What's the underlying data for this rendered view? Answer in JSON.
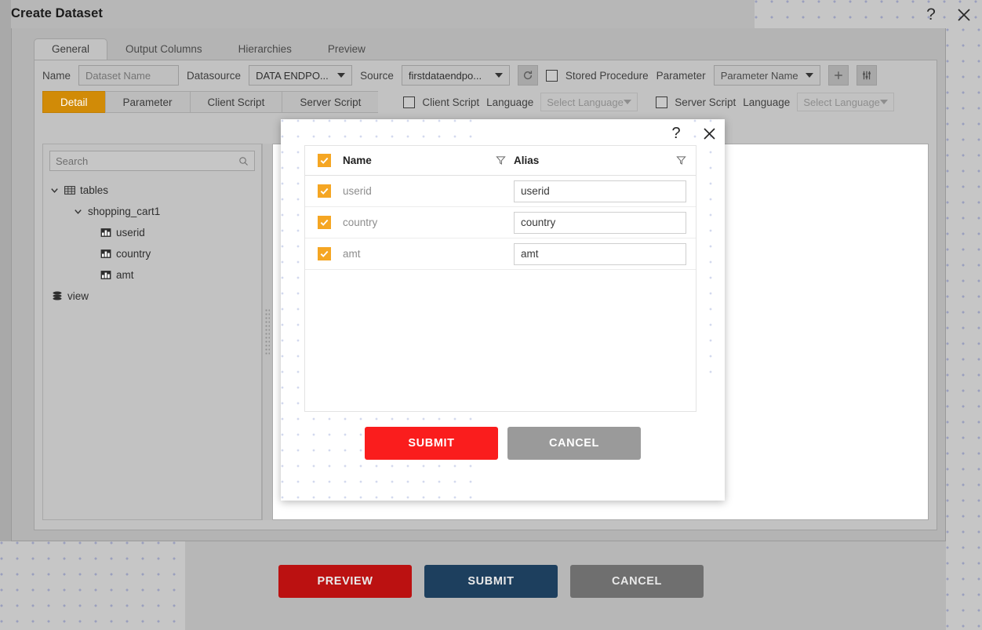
{
  "window": {
    "title": "Create Dataset",
    "help_icon": "question-mark-icon",
    "close_icon": "close-icon"
  },
  "tabs": [
    {
      "label": "General",
      "active": true
    },
    {
      "label": "Output Columns",
      "active": false
    },
    {
      "label": "Hierarchies",
      "active": false
    },
    {
      "label": "Preview",
      "active": false
    }
  ],
  "toolbar": {
    "name_label": "Name",
    "name_placeholder": "Dataset Name",
    "name_value": "",
    "datasource_label": "Datasource",
    "datasource_value": "DATA ENDPO...",
    "source_label": "Source",
    "source_value": "firstdataendpo...",
    "refresh_icon": "refresh-icon",
    "stored_procedure_label": "Stored Procedure",
    "stored_procedure_checked": false,
    "parameter_label": "Parameter",
    "parameter_name_value": "Parameter Name",
    "add_icon": "plus-icon",
    "settings_icon": "sliders-icon"
  },
  "subtabs": [
    {
      "label": "Detail",
      "active": true
    },
    {
      "label": "Parameter",
      "active": false
    },
    {
      "label": "Client Script",
      "active": false
    },
    {
      "label": "Server Script",
      "active": false
    }
  ],
  "script_options": {
    "client_script_label": "Client Script",
    "client_script_checked": false,
    "client_language_label": "Language",
    "client_language_value": "Select Language",
    "server_script_label": "Server Script",
    "server_script_checked": false,
    "server_language_label": "Language",
    "server_language_value": "Select Language"
  },
  "tree_panel": {
    "search_placeholder": "Search",
    "search_value": "",
    "search_icon": "search-icon",
    "nodes": [
      {
        "label": "tables",
        "depth": 0,
        "expanded": true,
        "icon": "table-icon"
      },
      {
        "label": "shopping_cart1",
        "depth": 1,
        "expanded": true,
        "icon": "none"
      },
      {
        "label": "userid",
        "depth": 2,
        "expanded": null,
        "icon": "column-icon"
      },
      {
        "label": "country",
        "depth": 2,
        "expanded": null,
        "icon": "column-icon"
      },
      {
        "label": "amt",
        "depth": 2,
        "expanded": null,
        "icon": "column-icon"
      },
      {
        "label": "view",
        "depth": 0,
        "expanded": null,
        "icon": "database-icon"
      }
    ]
  },
  "modal": {
    "help_icon": "question-mark-icon",
    "close_icon": "close-icon",
    "columns": {
      "select_all_checked": true,
      "name_header": "Name",
      "alias_header": "Alias",
      "name_filter_icon": "filter-icon",
      "alias_filter_icon": "filter-icon"
    },
    "rows": [
      {
        "checked": true,
        "name": "userid",
        "alias": "userid"
      },
      {
        "checked": true,
        "name": "country",
        "alias": "country"
      },
      {
        "checked": true,
        "name": "amt",
        "alias": "amt"
      }
    ],
    "submit_label": "SUBMIT",
    "cancel_label": "CANCEL",
    "submit_color": "#fa1d1d",
    "cancel_color": "#9a9a9a"
  },
  "footer": {
    "preview_label": "PREVIEW",
    "submit_label": "SUBMIT",
    "cancel_label": "CANCEL",
    "preview_color": "#bb1111",
    "submit_color": "#1d3f5e",
    "cancel_color": "#6f6f6f"
  }
}
